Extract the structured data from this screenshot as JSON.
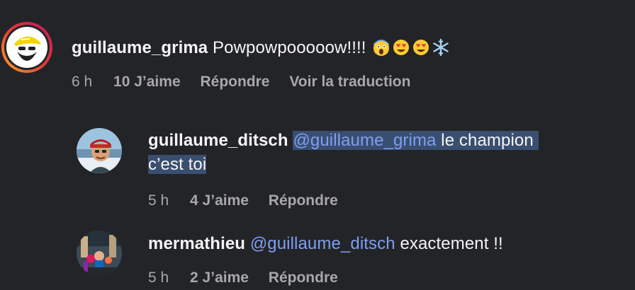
{
  "comments": [
    {
      "username": "guillaume_grima",
      "text": "Powpowpooooow!!!!",
      "emojis": [
        "scream-emoji",
        "heart-eyes-emoji",
        "heart-eyes-emoji",
        "snowflake-emoji"
      ],
      "time": "6 h",
      "likes": "10 J’aime",
      "reply": "Répondre",
      "translate": "Voir la traduction"
    },
    {
      "username": "guillaume_ditsch",
      "mention": "@guillaume_grima",
      "text_line1": " le champion",
      "text_line2": "c’est toi",
      "time": "5 h",
      "likes": "4 J’aime",
      "reply": "Répondre"
    },
    {
      "username": "mermathieu",
      "mention": "@guillaume_ditsch",
      "text": " exactement !!",
      "time": "5 h",
      "likes": "2 J’aime",
      "reply": "Répondre"
    }
  ],
  "colors": {
    "background": "#232428",
    "mention": "#7e9ff0",
    "meta": "#a8a8a8",
    "selection": "#3a4f70",
    "story_ring_start": "#f9a825",
    "story_ring_end": "#c2185b"
  }
}
